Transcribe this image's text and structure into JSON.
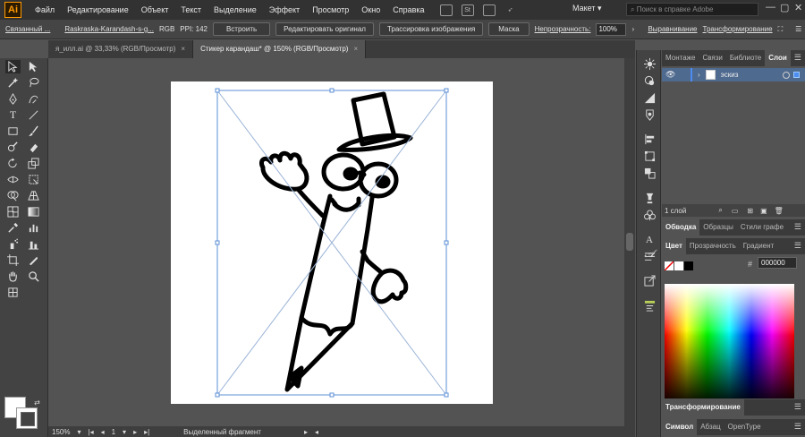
{
  "app": {
    "logo_text": "Ai",
    "accent": "#ff9a00"
  },
  "menu": {
    "items": [
      "Файл",
      "Редактирование",
      "Объект",
      "Текст",
      "Выделение",
      "Эффект",
      "Просмотр",
      "Окно",
      "Справка"
    ],
    "icon_st": "St",
    "workspace": "Макет",
    "search_placeholder": "Поиск в справке Adobe"
  },
  "control": {
    "type_label": "Связанный ...",
    "file_name": "Raskraska-Karandash-s-g...",
    "color_mode": "RGB",
    "ppi": "PPI: 142",
    "embed_btn": "Встроить",
    "edit_original_btn": "Редактировать оригинал",
    "trace_btn": "Трассировка изображения",
    "mask_btn": "Маска",
    "opacity_label": "Непрозрачность:",
    "opacity_value": "100%",
    "align_link": "Выравнивание",
    "transform_link": "Трансформирование"
  },
  "tabs": [
    {
      "label": "я_илл.ai @ 33,33% (RGB/Просмотр)",
      "close": "×"
    },
    {
      "label": "Стикер карандаш* @ 150% (RGB/Просмотр)",
      "close": "×"
    }
  ],
  "status": {
    "zoom": "150%",
    "artboard": "1",
    "info": "Выделенный фрагмент"
  },
  "layers_panel": {
    "tabs": [
      "Монтаже",
      "Связи",
      "Библиоте",
      "Слои"
    ],
    "active_tab": "Слои",
    "layer_name": "эскиз",
    "footer": "1 слой"
  },
  "stroke_panel": {
    "tabs": [
      "Обводка",
      "Образцы",
      "Стили графе"
    ]
  },
  "color_panel": {
    "tabs": [
      "Цвет",
      "Прозрачность",
      "Градиент"
    ],
    "hex": "000000"
  },
  "transform_panel": {
    "title": "Трансформирование"
  },
  "symbol_panel": {
    "tabs": [
      "Символ",
      "Абзац",
      "OpenType"
    ]
  }
}
